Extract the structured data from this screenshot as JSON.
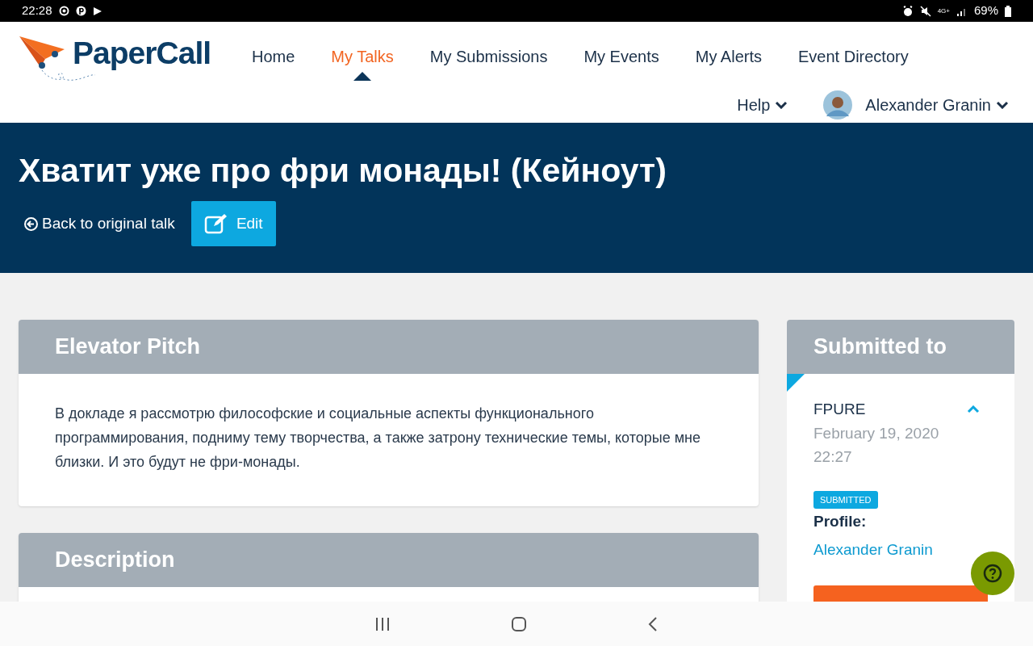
{
  "status_bar": {
    "time": "22:28",
    "network": "4G+",
    "battery": "69%"
  },
  "header": {
    "logo": "PaperCall",
    "nav": [
      {
        "label": "Home",
        "selected": false
      },
      {
        "label": "My Talks",
        "selected": true
      },
      {
        "label": "My Submissions",
        "selected": false
      },
      {
        "label": "My Events",
        "selected": false
      },
      {
        "label": "My Alerts",
        "selected": false
      },
      {
        "label": "Event Directory",
        "selected": false
      }
    ],
    "help": "Help",
    "user": "Alexander Granin"
  },
  "banner": {
    "title": "Хватит уже про фри монады! (Кейноут)",
    "back_link": "Back to original talk",
    "edit_button": "Edit"
  },
  "sections": [
    {
      "heading": "Elevator Pitch",
      "text": "В докладе я рассмотрю философские и социальные аспекты функционального программирования, подниму тему творчества, а также затрону технические темы, которые мне близки. И это будут не фри-монады."
    },
    {
      "heading": "Description"
    }
  ],
  "submitted_to": {
    "heading": "Submitted to",
    "event": "FPURE",
    "expanded": true,
    "date": "February 19, 2020",
    "time": "22:27",
    "status": "SUBMITTED",
    "profile_label": "Profile:",
    "profile_link": "Alexander Granin"
  }
}
